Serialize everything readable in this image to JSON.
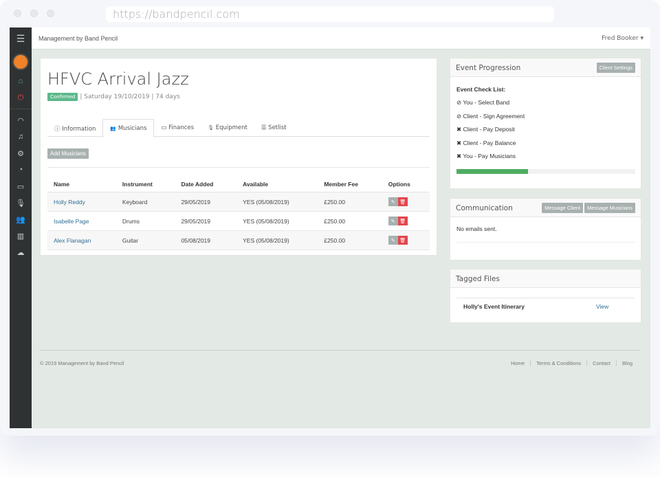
{
  "browser": {
    "url": "https://bandpencil.com"
  },
  "topbar": {
    "brand": "Management by Band Pencil",
    "user": "Fred Booker ▾"
  },
  "sidebar": {
    "icons": [
      "menu-icon",
      "logo",
      "dashboard-icon",
      "power-icon",
      "gauge-icon",
      "music-icon",
      "gear-icon",
      "pie-chart-icon",
      "credit-card-icon",
      "microphone-icon",
      "users-icon",
      "barcode-icon",
      "cloud-icon"
    ]
  },
  "event": {
    "title": "HFVC Arrival Jazz",
    "status": "Confirmed",
    "meta": "| Saturday 19/10/2019 | 74 days"
  },
  "tabs": [
    {
      "label": "Information",
      "icon": "ⓘ"
    },
    {
      "label": "Musicians",
      "icon": "👥"
    },
    {
      "label": "Finances",
      "icon": "▭"
    },
    {
      "label": "Equipment",
      "icon": "🎙"
    },
    {
      "label": "Setlist",
      "icon": "☰"
    }
  ],
  "add_musicians": "Add Musicians",
  "table": {
    "headers": [
      "Name",
      "Instrument",
      "Date Added",
      "Available",
      "Member Fee",
      "Options"
    ],
    "rows": [
      {
        "name": "Holly Reddy",
        "instrument": "Keyboard",
        "date_added": "29/05/2019",
        "available": "YES (05/08/2019)",
        "fee": "£250.00"
      },
      {
        "name": "Isabelle Page",
        "instrument": "Drums",
        "date_added": "29/05/2019",
        "available": "YES (05/08/2019)",
        "fee": "£250.00"
      },
      {
        "name": "Alex Flanagan",
        "instrument": "Guitar",
        "date_added": "05/08/2019",
        "available": "YES (05/08/2019)",
        "fee": "£250.00"
      }
    ]
  },
  "progression": {
    "title": "Event Progression",
    "button": "Client Settings",
    "checklist_title": "Event Check List:",
    "items": [
      {
        "icon": "⊘",
        "label": "You - Select Band"
      },
      {
        "icon": "⊘",
        "label": "Client - Sign Agreement"
      },
      {
        "icon": "✖",
        "label": "Client - Pay Deposit"
      },
      {
        "icon": "✖",
        "label": "Client - Pay Balance"
      },
      {
        "icon": "✖",
        "label": "You - Pay Musicians"
      }
    ],
    "progress_percent": 40,
    "color": "#4ead63"
  },
  "communication": {
    "title": "Communication",
    "btn_client": "Message Client",
    "btn_musicians": "Message Musicians",
    "empty": "No emails sent."
  },
  "files": {
    "title": "Tagged Files",
    "file": "Holly's Event Itinerary",
    "view": "View"
  },
  "footer": {
    "copyright": "© 2019 Management by Band Pencil",
    "links": [
      "Home",
      "Terms & Conditions",
      "Contact",
      "Blog"
    ]
  }
}
